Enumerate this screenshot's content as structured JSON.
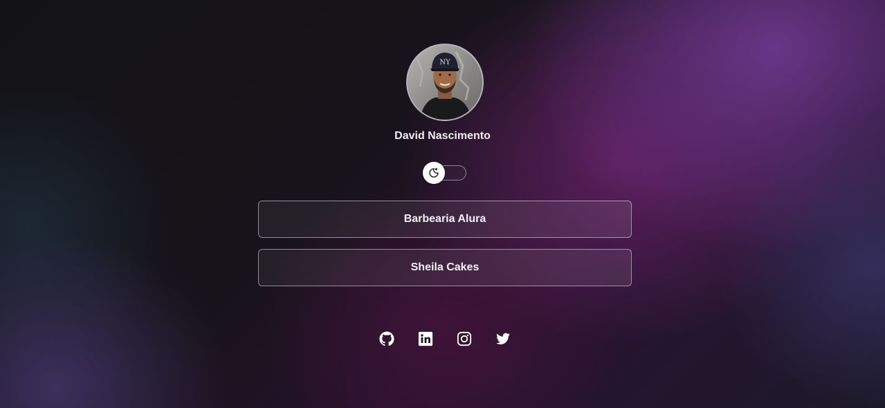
{
  "profile": {
    "name": "David Nascimento",
    "avatar_alt": "avatar"
  },
  "theme_toggle": {
    "icon": "moon-sun-icon",
    "state": "dark"
  },
  "links": [
    {
      "label": "Barbearia Alura"
    },
    {
      "label": "Sheila Cakes"
    }
  ],
  "social": [
    {
      "icon": "github-icon"
    },
    {
      "icon": "linkedin-icon"
    },
    {
      "icon": "instagram-icon"
    },
    {
      "icon": "twitter-icon"
    }
  ],
  "colors": {
    "accent_purple": "#6b2a7a",
    "button_border": "#d8d0de",
    "text": "#f4f1f7"
  }
}
